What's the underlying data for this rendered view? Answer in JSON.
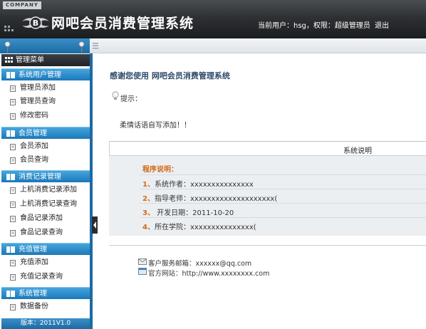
{
  "header": {
    "company": "COMPANY",
    "title": "网吧会员消费管理系统",
    "user_info": "当前用户：hsg，权限：超级管理员",
    "logout_label": "退出"
  },
  "sidebar": {
    "menu_title": "管理菜单",
    "groups": [
      {
        "title": "系统用户管理",
        "items": [
          "管理员添加",
          "管理员查询",
          "修改密码"
        ]
      },
      {
        "title": "会员管理",
        "items": [
          "会员添加",
          "会员查询"
        ]
      },
      {
        "title": "消费记录管理",
        "items": [
          "上机消费记录添加",
          "上机消费记录查询",
          "食品记录添加",
          "食品记录查询"
        ]
      },
      {
        "title": "充值管理",
        "items": [
          "充值添加",
          "充值记录查询"
        ]
      },
      {
        "title": "系统管理",
        "items": [
          "数据备份"
        ]
      }
    ],
    "version": "版本：2011V1.0"
  },
  "main": {
    "thanks": "感谢您使用  网吧会员消费管理系统",
    "tip_label": "提示：",
    "greeting": "柔情话语自写添加！！",
    "panel_header": "系统说明",
    "program_title": "程序说明：",
    "rows": [
      {
        "num": "1、",
        "text": "系统作者：xxxxxxxxxxxxxxx"
      },
      {
        "num": "2、",
        "text": "指导老师：xxxxxxxxxxxxxxxxxxxx("
      },
      {
        "num": "3、",
        "text": " 开发日期：2011-10-20"
      },
      {
        "num": "4、",
        "text": "所在学院：xxxxxxxxxxxxxxx("
      }
    ],
    "email": "客户服务邮箱：xxxxxx@qq.com",
    "website": "官方网站：http://www.xxxxxxxx.com"
  },
  "colors": {
    "accent_blue": "#1d6aa3",
    "header_dark": "#2e3134",
    "orange": "#d26a17"
  },
  "icons": [
    "bentley-logo-icon",
    "grid-icon",
    "pin-icon",
    "grip-icon",
    "menu-list-icon",
    "folder-icon",
    "document-icon",
    "tip-bulb-icon",
    "mail-icon",
    "website-icon"
  ]
}
